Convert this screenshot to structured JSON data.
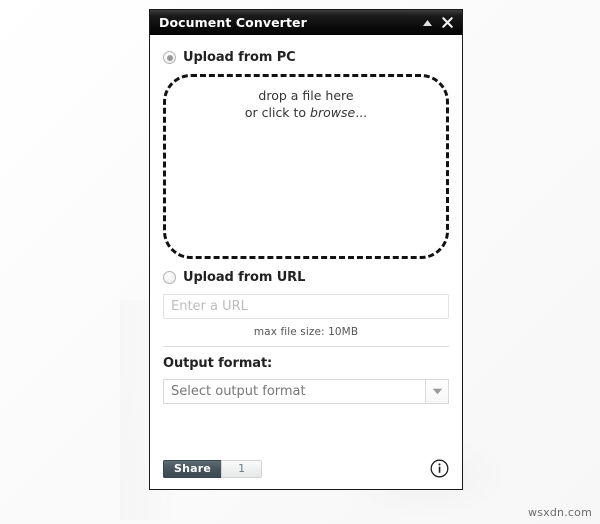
{
  "window": {
    "title": "Document Converter",
    "collapse_icon": "triangle-up-icon",
    "close_icon": "close-icon"
  },
  "upload_pc": {
    "label": "Upload from PC",
    "selected": true,
    "dropzone": {
      "line1": "drop a file here",
      "line2_prefix": "or click to ",
      "line2_emphasis": "browse",
      "line2_suffix": "..."
    }
  },
  "upload_url": {
    "label": "Upload from URL",
    "selected": false,
    "input_value": "",
    "input_placeholder": "Enter a URL"
  },
  "max_file_size": "max file size: 10MB",
  "output": {
    "label": "Output format:",
    "selected_value": "Select output format",
    "arrow_icon": "chevron-down-icon"
  },
  "footer": {
    "share_label": "Share",
    "share_count": "1",
    "info_icon": "info-circle-icon"
  },
  "watermark": "wsxdn.com",
  "colors": {
    "titlebar": "#0a0a0a",
    "panel_border": "#1a1a1a",
    "dropzone_border": "#121212",
    "share_button": "#46545c",
    "text": "#222222"
  }
}
